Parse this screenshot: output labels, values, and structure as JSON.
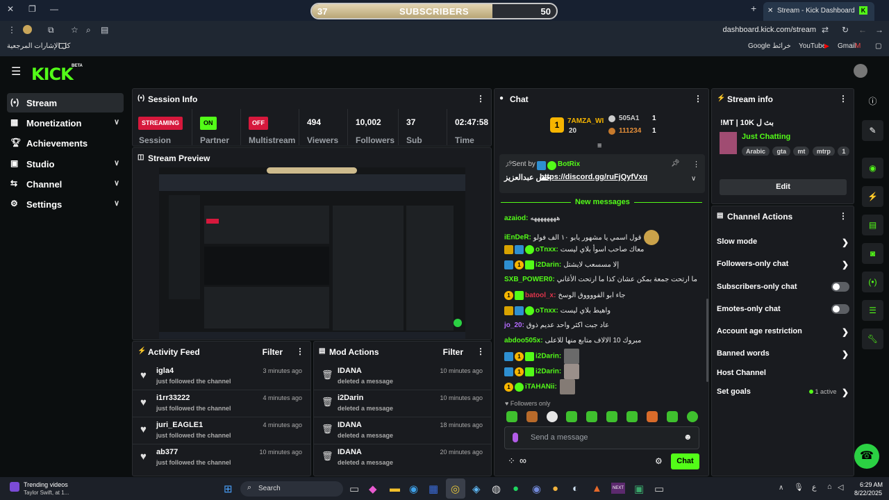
{
  "browser": {
    "sub_bar": {
      "left": "37",
      "center": "SUBSCRIBERS",
      "right": "50",
      "progress": 0.74
    },
    "tab_title": "Stream - Kick Dashboard",
    "url": "dashboard.kick.com/stream",
    "bookmarks_all": "كل الإشارات المرجعية",
    "bookmarks": [
      "Google خرائط",
      "YouTube",
      "Gmail"
    ]
  },
  "sidebar": {
    "items": [
      {
        "label": "Stream",
        "icon": "stream-icon",
        "active": true,
        "expand": false
      },
      {
        "label": "Monetization",
        "icon": "monetization-icon",
        "expand": true
      },
      {
        "label": "Achievements",
        "icon": "trophy-icon",
        "expand": false
      },
      {
        "label": "Studio",
        "icon": "studio-icon",
        "expand": true
      },
      {
        "label": "Channel",
        "icon": "channel-icon",
        "expand": true
      },
      {
        "label": "Settings",
        "icon": "gear-icon",
        "expand": true
      }
    ]
  },
  "session": {
    "title": "Session Info",
    "stats": [
      {
        "value": "STREAMING",
        "label": "Session"
      },
      {
        "value": "ON",
        "label": "Partner"
      },
      {
        "value": "OFF",
        "label": "Multistream"
      },
      {
        "value": "494",
        "label": "Viewers"
      },
      {
        "value": "10,002",
        "label": "Followers"
      },
      {
        "value": "37",
        "label": "Sub"
      },
      {
        "value": "02:47:58",
        "label": "Time"
      }
    ]
  },
  "preview": {
    "title": "Stream Preview"
  },
  "activity": {
    "title": "Activity Feed",
    "filter": "Filter",
    "rows": [
      {
        "name": "igla4",
        "desc": "just followed the channel",
        "time": "3 minutes ago"
      },
      {
        "name": "i1rr33222",
        "desc": "just followed the channel",
        "time": "4 minutes ago"
      },
      {
        "name": "juri_EAGLE1",
        "desc": "just followed the channel",
        "time": "4 minutes ago"
      },
      {
        "name": "ab377",
        "desc": "just followed the channel",
        "time": "10 minutes ago"
      }
    ]
  },
  "mod": {
    "title": "Mod Actions",
    "filter": "Filter",
    "rows": [
      {
        "name": "IDANA",
        "desc": "deleted a message",
        "time": "10 minutes ago"
      },
      {
        "name": "i2Darin",
        "desc": "deleted a message",
        "time": "10 minutes ago"
      },
      {
        "name": "IDANA",
        "desc": "deleted a message",
        "time": "18 minutes ago"
      },
      {
        "name": "IDANA",
        "desc": "deleted a message",
        "time": "20 minutes ago"
      }
    ]
  },
  "chat": {
    "title": "Chat",
    "leaders": {
      "name1": "7AMZA_WI",
      "val1": "20",
      "name2": "505A1",
      "val2": "1",
      "name3": "111234",
      "val3": "1"
    },
    "pinned": {
      "sent_by": "Sent by",
      "bot": "BotRix",
      "text": "حس عبدالعزيز",
      "link": "https://discord.gg/ruFjQyfVxq"
    },
    "new_messages": "New messages",
    "messages": [
      {
        "user": "azaiod:",
        "color": "#53fc18",
        "text": "ههههههههه"
      },
      {
        "user": "iEnDeR:",
        "color": "#53fc18",
        "text": "قول اسمي يا مشهور يابو ١٠ الف فولو"
      },
      {
        "user": "oTnxx:",
        "color": "#53fc18",
        "text": "معاك صاحب اسوأ بلاي ليست"
      },
      {
        "user": "i2Darin:",
        "color": "#53fc18",
        "text": "إلا مسسعب لايشتل"
      },
      {
        "user": "SXB_POWER0:",
        "color": "#53fc18",
        "text": "ما ارتحت جمعة بمكن عشان كذا ما ارتحت الأغاني"
      },
      {
        "user": "batool_x:",
        "color": "#e0344b",
        "text": "جاء ابو الفووووق الوسخ"
      },
      {
        "user": "oTnxx:",
        "color": "#53fc18",
        "text": "واهيط بلاي ليست"
      },
      {
        "user": "jo_20:",
        "color": "#b56bff",
        "text": "عاد جبت اكثر واحد عديم ذوق"
      },
      {
        "user": "abdoo505x:",
        "color": "#53fc18",
        "text": "مبروك 10 الالاف متابع منها للاعلى"
      },
      {
        "user": "i2Darin:",
        "color": "#53fc18",
        "text": ""
      },
      {
        "user": "i2Darin:",
        "color": "#53fc18",
        "text": ""
      },
      {
        "user": "iTAHANii:",
        "color": "#53fc18",
        "text": ""
      }
    ],
    "followers_only": "Followers only",
    "placeholder": "Send a message",
    "send": "Chat"
  },
  "stream_info": {
    "title": "Stream info",
    "stream_title": "!MT | 10K بث ل",
    "category": "Just Chatting",
    "tags": [
      "Arabic",
      "gta",
      "mt",
      "mtrp",
      "1"
    ],
    "edit": "Edit"
  },
  "channel_actions": {
    "title": "Channel Actions",
    "rows": [
      {
        "label": "Slow mode",
        "kind": "chevron"
      },
      {
        "label": "Followers-only chat",
        "kind": "chevron"
      },
      {
        "label": "Subscribers-only chat",
        "kind": "toggle"
      },
      {
        "label": "Emotes-only chat",
        "kind": "toggle"
      },
      {
        "label": "Account age restriction",
        "kind": "chevron"
      },
      {
        "label": "Banned words",
        "kind": "chevron"
      },
      {
        "label": "Host Channel",
        "kind": "none"
      },
      {
        "label": "Set goals",
        "kind": "chevron",
        "extra": "1 active"
      }
    ]
  },
  "taskbar": {
    "trend_title": "Trending videos",
    "trend_sub": "Taylor Swift, at 1...",
    "search": "Search",
    "lang": "ع",
    "time": "6:29 AM",
    "date": "8/22/2025"
  },
  "colors": {
    "accent": "#53fc18",
    "live": "#d6183c",
    "panel": "#191b1f"
  }
}
